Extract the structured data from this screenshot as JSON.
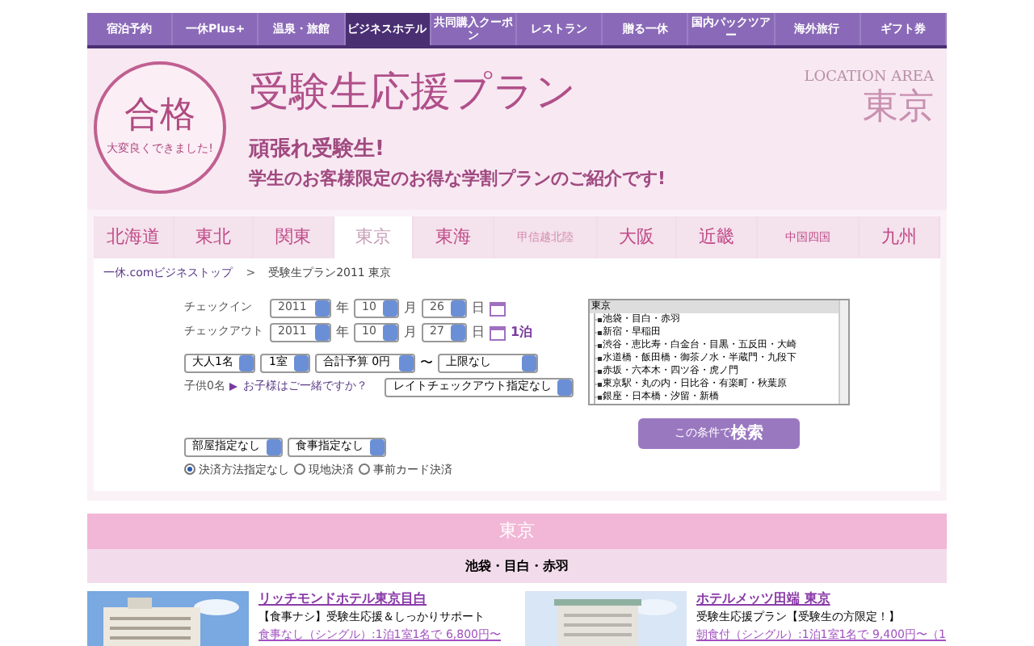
{
  "nav": [
    {
      "label": "宿泊予約",
      "selected": false
    },
    {
      "label": "一休Plus+",
      "selected": false
    },
    {
      "label": "温泉・旅館",
      "selected": false
    },
    {
      "label": "ビジネスホテル",
      "selected": true
    },
    {
      "label": "共同購入クーポン",
      "selected": false
    },
    {
      "label": "レストラン",
      "selected": false
    },
    {
      "label": "贈る一休",
      "selected": false
    },
    {
      "label": "国内パックツアー",
      "selected": false
    },
    {
      "label": "海外旅行",
      "selected": false
    },
    {
      "label": "ギフト券",
      "selected": false
    }
  ],
  "banner": {
    "badge": "合格",
    "badge_sub": "大変良くできました!",
    "title": "受験生応援プラン",
    "subtitle": "頑張れ受験生!",
    "description": "学生のお客様限定のお得な学割プランのご紹介です!",
    "location_label": "LOCATION AREA",
    "location": "東京"
  },
  "regions": [
    {
      "label": "北海道",
      "selected": false,
      "disabled": false
    },
    {
      "label": "東北",
      "selected": false,
      "disabled": false
    },
    {
      "label": "関東",
      "selected": false,
      "disabled": false
    },
    {
      "label": "東京",
      "selected": true,
      "disabled": false
    },
    {
      "label": "東海",
      "selected": false,
      "disabled": false
    },
    {
      "label": "甲信越北陸",
      "selected": false,
      "disabled": true
    },
    {
      "label": "大阪",
      "selected": false,
      "disabled": false
    },
    {
      "label": "近畿",
      "selected": false,
      "disabled": false
    },
    {
      "label": "中国四国",
      "selected": false,
      "disabled": false
    },
    {
      "label": "九州",
      "selected": false,
      "disabled": false
    }
  ],
  "breadcrumb": {
    "link": "一休.comビジネストップ",
    "separator": ">",
    "current": "受験生プラン2011 東京"
  },
  "form": {
    "checkin": {
      "label": "チェックイン",
      "year": "2011",
      "year_unit": "年",
      "month": "10",
      "month_unit": "月",
      "day": "26",
      "day_unit": "日"
    },
    "checkout": {
      "label": "チェックアウト",
      "year": "2011",
      "year_unit": "年",
      "month": "10",
      "month_unit": "月",
      "day": "27",
      "day_unit": "日",
      "nights": "1泊"
    },
    "adults": "大人1名",
    "rooms": "1室",
    "budget_min": "合計予算 0円",
    "range_sep": "〜",
    "budget_max": "上限なし",
    "children": "子供0名",
    "children_link": "お子様はご一緒ですか？",
    "late_checkout": "レイトチェックアウト指定なし",
    "room_type": "部屋指定なし",
    "meal": "食事指定なし",
    "payment": [
      {
        "label": "決済方法指定なし",
        "selected": true
      },
      {
        "label": "現地決済",
        "selected": false
      },
      {
        "label": "事前カード決済",
        "selected": false
      }
    ],
    "areas": {
      "header": "東京",
      "items": [
        "池袋・目白・赤羽",
        "新宿・早稲田",
        "渋谷・恵比寿・白金台・目黒・五反田・大崎",
        "水道橋・飯田橋・御茶ノ水・半蔵門・九段下",
        "赤坂・六本木・四ツ谷・虎ノ門",
        "東京駅・丸の内・日比谷・有楽町・秋葉原",
        "銀座・日本橋・汐留・新橋"
      ]
    },
    "search_button": {
      "prefix": "この条件で",
      "label": "検索"
    }
  },
  "section": {
    "title": "東京",
    "subtitle": "池袋・目白・赤羽"
  },
  "hotels": [
    {
      "name": "リッチモンドホテル東京目白",
      "description": "【食事ナシ】受験生応援＆しっかりサポート",
      "price": "食事なし（シングル）:1泊1室1名で 6,800円〜"
    },
    {
      "name": "ホテルメッツ田端 東京",
      "description": "受験生応援プラン【受験生の方限定！】",
      "price": "朝食付（シングル）:1泊1室1名で 9,400円〜（1"
    }
  ]
}
